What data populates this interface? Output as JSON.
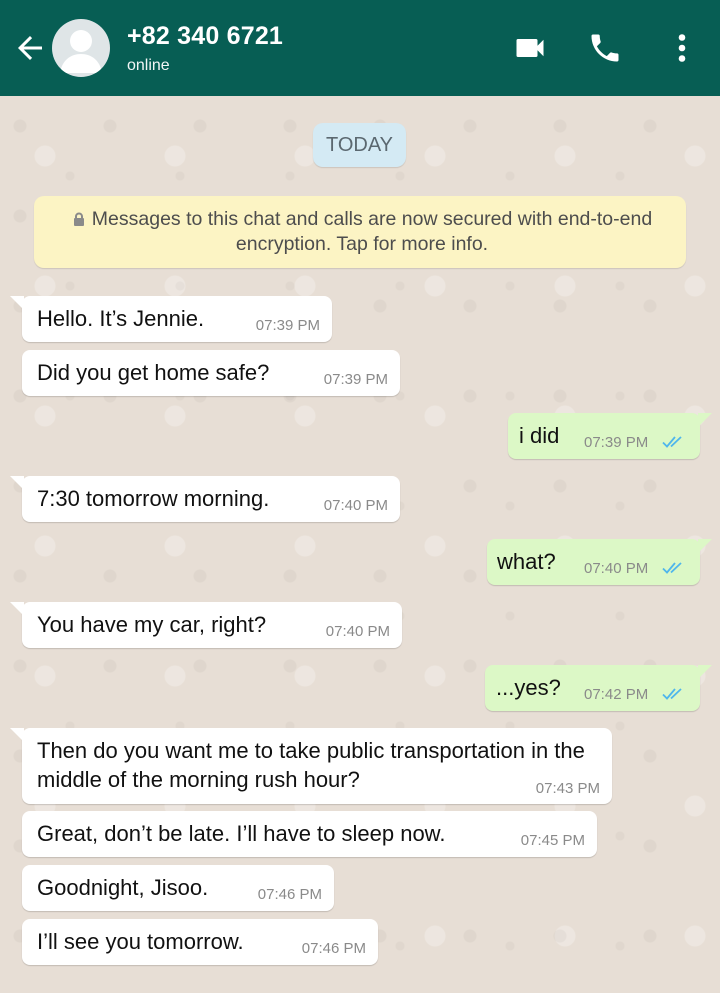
{
  "header": {
    "contact_name": "+82 340 6721",
    "status": "online",
    "icons": [
      "back-arrow-icon",
      "avatar-icon",
      "video-call-icon",
      "voice-call-icon",
      "more-options-icon"
    ]
  },
  "colors": {
    "header": "#075e54",
    "incoming_bubble": "#ffffff",
    "outgoing_bubble": "#dcf8c6",
    "read_ticks": "#4fb6ec",
    "notice": "#fcf4c4",
    "date_chip": "#d4eaf4"
  },
  "chat": {
    "date_label": "TODAY",
    "encryption_notice": "Messages to this chat and calls are now secured with end-to-end encryption. Tap for more info.",
    "messages": [
      {
        "direction": "incoming",
        "text": "Hello. It’s Jennie.",
        "time": "07:39 PM"
      },
      {
        "direction": "incoming",
        "text": "Did you get home safe?",
        "time": "07:39 PM"
      },
      {
        "direction": "outgoing",
        "text": "i did",
        "time": "07:39 PM",
        "status": "read"
      },
      {
        "direction": "incoming",
        "text": "7:30 tomorrow morning.",
        "time": "07:40 PM"
      },
      {
        "direction": "outgoing",
        "text": "what?",
        "time": "07:40 PM",
        "status": "read"
      },
      {
        "direction": "incoming",
        "text": "You have my car, right?",
        "time": "07:40 PM"
      },
      {
        "direction": "outgoing",
        "text": "...yes?",
        "time": "07:42 PM",
        "status": "read"
      },
      {
        "direction": "incoming",
        "text": "Then do you want me to take public transportation in the middle of the morning rush hour?",
        "time": "07:43 PM"
      },
      {
        "direction": "incoming",
        "text": "Great, don’t be late. I’ll have to sleep now.",
        "time": "07:45 PM"
      },
      {
        "direction": "incoming",
        "text": "Goodnight, Jisoo.",
        "time": "07:46 PM"
      },
      {
        "direction": "incoming",
        "text": "I’ll see you tomorrow.",
        "time": "07:46 PM"
      }
    ]
  }
}
